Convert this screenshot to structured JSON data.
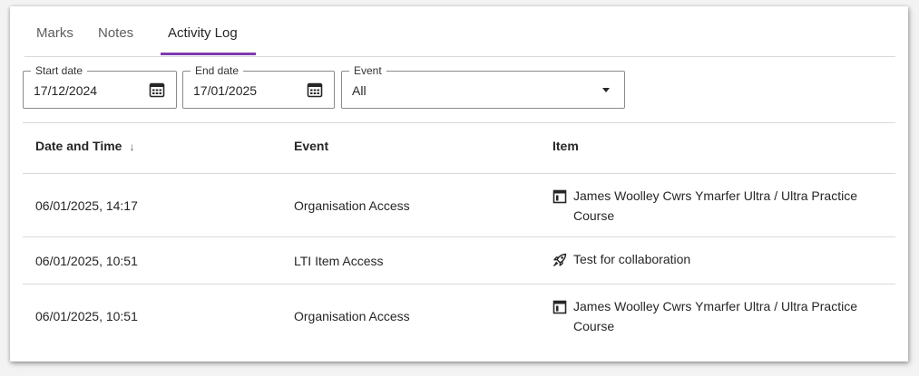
{
  "tabs": [
    {
      "label": "Marks"
    },
    {
      "label": "Notes"
    },
    {
      "label": "Activity Log"
    }
  ],
  "filters": {
    "start_date": {
      "label": "Start date",
      "value": "17/12/2024"
    },
    "end_date": {
      "label": "End date",
      "value": "17/01/2025"
    },
    "event": {
      "label": "Event",
      "value": "All"
    }
  },
  "table": {
    "headers": {
      "date_time": "Date and Time",
      "sort_indicator": "↓",
      "event": "Event",
      "item": "Item"
    },
    "rows": [
      {
        "date_time": "06/01/2025, 14:17",
        "event": "Organisation Access",
        "item": "James Woolley Cwrs Ymarfer Ultra / Ultra Practice Course",
        "item_icon": "course-icon"
      },
      {
        "date_time": "06/01/2025, 10:51",
        "event": "LTI Item Access",
        "item": "Test for collaboration",
        "item_icon": "rocket-icon"
      },
      {
        "date_time": "06/01/2025, 10:51",
        "event": "Organisation Access",
        "item": "James Woolley Cwrs Ymarfer Ultra / Ultra Practice Course",
        "item_icon": "course-icon"
      }
    ]
  },
  "colors": {
    "accent": "#7e3ab0",
    "divider": "#d9d9d9",
    "text": "#262626"
  }
}
